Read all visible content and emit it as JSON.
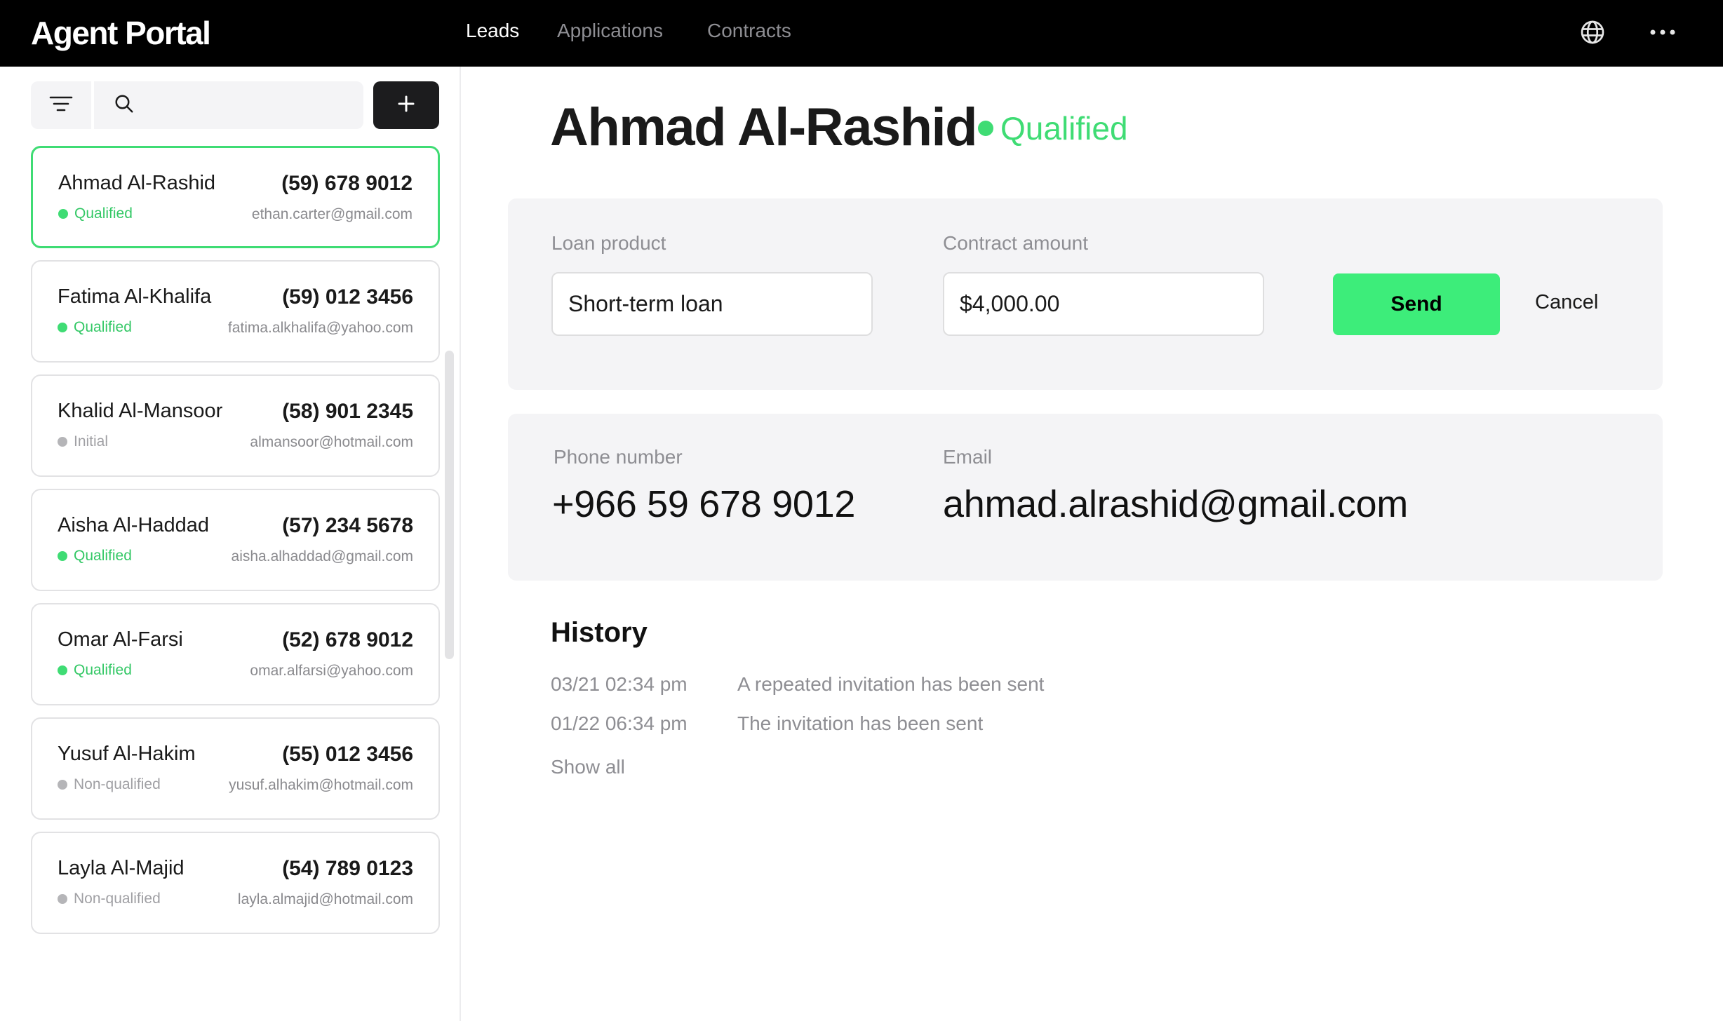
{
  "app": {
    "title": "Agent Portal",
    "nav": [
      {
        "label": "Leads",
        "active": true
      },
      {
        "label": "Applications",
        "active": false
      },
      {
        "label": "Contracts",
        "active": false
      }
    ],
    "icons": {
      "language": "globe-icon",
      "more": "more-horizontal-icon"
    }
  },
  "sidebar": {
    "filter_icon": "filter-icon",
    "search": {
      "placeholder": "",
      "value": "",
      "icon": "search-icon"
    },
    "add_icon": "plus-icon",
    "leads": [
      {
        "name": "Ahmad Al-Rashid",
        "phone": "(59) 678 9012",
        "status": "Qualified",
        "email": "ethan.carter@gmail.com",
        "selected": true
      },
      {
        "name": "Fatima Al-Khalifa",
        "phone": "(59) 012 3456",
        "status": "Qualified",
        "email": "fatima.alkhalifa@yahoo.com",
        "selected": false
      },
      {
        "name": "Khalid Al-Mansoor",
        "phone": "(58) 901 2345",
        "status": "Initial",
        "email": "almansoor@hotmail.com",
        "selected": false
      },
      {
        "name": "Aisha Al-Haddad",
        "phone": "(57) 234 5678",
        "status": "Qualified",
        "email": "aisha.alhaddad@gmail.com",
        "selected": false
      },
      {
        "name": "Omar Al-Farsi",
        "phone": "(52) 678 9012",
        "status": "Qualified",
        "email": "omar.alfarsi@yahoo.com",
        "selected": false
      },
      {
        "name": "Yusuf Al-Hakim",
        "phone": "(55) 012 3456",
        "status": "Non-qualified",
        "email": "yusuf.alhakim@hotmail.com",
        "selected": false
      },
      {
        "name": "Layla Al-Majid",
        "phone": "(54) 789 0123",
        "status": "Non-qualified",
        "email": "layla.almajid@hotmail.com",
        "selected": false
      }
    ]
  },
  "status_colors": {
    "Qualified": "#3fdc74",
    "Initial": "#b5b5b8",
    "Non-qualified": "#b5b5b8"
  },
  "status_text_colors": {
    "Qualified": "#34c866",
    "Initial": "#a0a0a4",
    "Non-qualified": "#a0a0a4"
  },
  "detail": {
    "name": "Ahmad Al-Rashid",
    "status": "Qualified",
    "form": {
      "loan_product_label": "Loan product",
      "loan_product_value": "Short-term loan",
      "contract_amount_label": "Contract amount",
      "contract_amount_value": "$4,000.00",
      "send_label": "Send",
      "cancel_label": "Cancel"
    },
    "contact": {
      "phone_label": "Phone number",
      "phone_value": "+966 59 678 9012",
      "email_label": "Email",
      "email_value": "ahmad.alrashid@gmail.com"
    },
    "history": {
      "title": "History",
      "items": [
        {
          "date": "03/21 02:34 pm",
          "text": "A repeated invitation has been sent"
        },
        {
          "date": "01/22 06:34 pm",
          "text": "The invitation has been sent"
        }
      ],
      "show_all_label": "Show all"
    }
  },
  "colors": {
    "accent": "#3ded7a",
    "header_bg": "#000000",
    "panel_bg": "#f4f4f6"
  }
}
